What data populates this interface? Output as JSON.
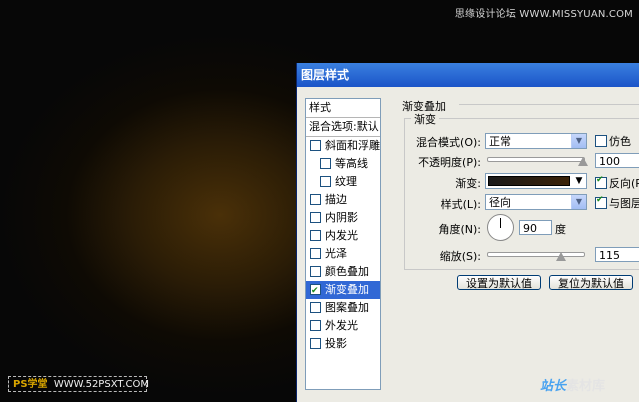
{
  "watermark_top": "思缘设计论坛  WWW.MISSYUAN.COM",
  "dialog": {
    "title": "图层样式",
    "styles_header": "样式",
    "blend_options": "混合选项:默认",
    "styles": [
      {
        "label": "斜面和浮雕",
        "checked": false
      },
      {
        "label": "等高线",
        "checked": false
      },
      {
        "label": "纹理",
        "checked": false
      },
      {
        "label": "描边",
        "checked": false
      },
      {
        "label": "内阴影",
        "checked": false
      },
      {
        "label": "内发光",
        "checked": false
      },
      {
        "label": "光泽",
        "checked": false
      },
      {
        "label": "颜色叠加",
        "checked": false
      },
      {
        "label": "渐变叠加",
        "checked": true
      },
      {
        "label": "图案叠加",
        "checked": false
      },
      {
        "label": "外发光",
        "checked": false
      },
      {
        "label": "投影",
        "checked": false
      }
    ],
    "group_title": "渐变叠加",
    "inner_title": "渐变",
    "blend_mode_label": "混合模式(O):",
    "blend_mode_value": "正常",
    "dither_label": "仿色",
    "dither_checked": false,
    "opacity_label": "不透明度(P):",
    "opacity_value": "100",
    "opacity_fraction": 1.0,
    "gradient_label": "渐变:",
    "reverse_label": "反向(R)",
    "reverse_checked": true,
    "style_label": "样式(L):",
    "style_value": "径向",
    "align_label": "与图层",
    "align_checked": true,
    "angle_label": "角度(N):",
    "angle_value": "90",
    "angle_unit": "度",
    "scale_label": "缩放(S):",
    "scale_value": "115",
    "scale_fraction": 0.77,
    "btn_default": "设置为默认值",
    "btn_reset": "复位为默认值"
  },
  "watermark_left": {
    "ps": "PS学堂",
    "site": "WWW.52PSXT.COM"
  },
  "watermark_right": {
    "a": "站长",
    "b": "素材库"
  }
}
